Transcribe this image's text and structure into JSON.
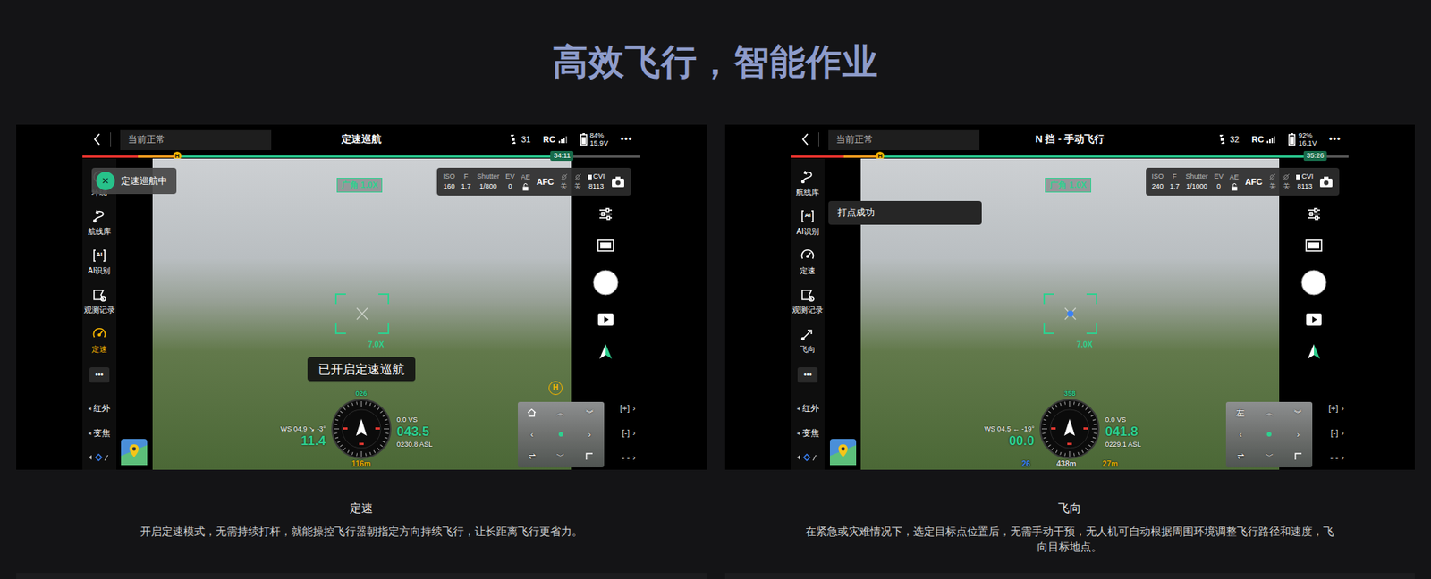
{
  "page": {
    "title": "高效飞行，智能作业"
  },
  "panels": [
    {
      "topbar": {
        "status": "当前正常",
        "mode": "定速巡航",
        "signal": "31",
        "rc": "RC",
        "battery": "84%",
        "voltage": "15.9V",
        "more": "•••"
      },
      "flight_bar": {
        "level": 0.86,
        "critical_level": 0.1,
        "low_level": 0.17,
        "home_mark": "H",
        "time": "34:11"
      },
      "toast": {
        "kind": "mode",
        "text": "定速巡航中",
        "close": "✕"
      },
      "sidebar": [
        {
          "label": "环绕",
          "kind": "orbit",
          "selected": false
        },
        {
          "label": "航线库",
          "kind": "route",
          "selected": false
        },
        {
          "label": "AI识别",
          "kind": "ai",
          "glyph": "AI",
          "selected": false
        },
        {
          "label": "观测记录",
          "kind": "record",
          "selected": false
        },
        {
          "label": "定速",
          "kind": "speed",
          "selected": true
        }
      ],
      "sidebar_more": "•••",
      "submenus": [
        {
          "label": "红外",
          "arrow": "◂"
        },
        {
          "label": "变焦",
          "arrow": "◂"
        }
      ],
      "lens": "广角 1.0X",
      "camera": {
        "params": [
          {
            "label": "ISO",
            "value": "160"
          },
          {
            "label": "F",
            "value": "1.7"
          },
          {
            "label": "Shutter",
            "value": "1/800"
          },
          {
            "label": "EV",
            "value": "0"
          }
        ],
        "ae": {
          "label": "AE",
          "locked": false
        },
        "focus": "AFC",
        "switches": [
          {
            "label": "关",
            "on": false
          },
          {
            "label": "关",
            "on": false
          }
        ],
        "codec": "CVI",
        "storage": "8113"
      },
      "reticle": {
        "zoom": "7.0X",
        "target": false
      },
      "notice": "已开启定速巡航",
      "home_marker": "H",
      "telemetry": {
        "wind": "WS 04.9 ↘ -3°",
        "speed": "11.4",
        "vs": "0.0 VS",
        "altitude": "043.5",
        "asl": "0230.8 ASL",
        "heading": "026",
        "marks": [
          {
            "text": "116m",
            "color": "#e0a800"
          }
        ]
      },
      "minimap": {
        "label": null,
        "up": "︿",
        "down": "﹀",
        "left": "‹",
        "right": "›",
        "swap": "⇌",
        "collapse": "︾"
      },
      "zoom_buttons": [
        {
          "label": "[+]",
          "arrow": "›"
        },
        {
          "label": "[-]",
          "arrow": "›"
        },
        {
          "label": "- -",
          "arrow": "›"
        }
      ],
      "caption": {
        "title": "定速",
        "text": "开启定速模式，无需持续打杆，就能操控飞行器朝指定方向持续飞行，让长距离飞行更省力。"
      }
    },
    {
      "topbar": {
        "status": "当前正常",
        "mode": "N 挡 - 手动飞行",
        "signal": "32",
        "rc": "RC",
        "battery": "92%",
        "voltage": "16.1V",
        "more": "•••"
      },
      "flight_bar": {
        "level": 0.94,
        "critical_level": 0.095,
        "low_level": 0.16,
        "home_mark": "H",
        "time": "35:26"
      },
      "toast": {
        "kind": "info",
        "text": "打点成功"
      },
      "sidebar": [
        {
          "label": "航线库",
          "kind": "route",
          "selected": false
        },
        {
          "label": "AI识别",
          "kind": "ai",
          "glyph": "AI",
          "selected": false
        },
        {
          "label": "定速",
          "kind": "speed",
          "selected": false
        },
        {
          "label": "观测记录",
          "kind": "record",
          "selected": false
        },
        {
          "label": "飞向",
          "kind": "goto",
          "selected": false
        }
      ],
      "sidebar_more": "•••",
      "submenus": [
        {
          "label": "红外",
          "arrow": "◂"
        },
        {
          "label": "变焦",
          "arrow": "◂"
        }
      ],
      "lens": "广角 1.0X",
      "camera": {
        "params": [
          {
            "label": "ISO",
            "value": "240"
          },
          {
            "label": "F",
            "value": "1.7"
          },
          {
            "label": "Shutter",
            "value": "1/1000"
          },
          {
            "label": "EV",
            "value": "0"
          }
        ],
        "ae": {
          "label": "AE",
          "locked": false
        },
        "focus": "AFC",
        "switches": [
          {
            "label": "关",
            "on": false
          },
          {
            "label": "关",
            "on": false
          }
        ],
        "codec": "CVI",
        "storage": "8113"
      },
      "reticle": {
        "zoom": "7.0X",
        "target": true
      },
      "notice": null,
      "home_marker": null,
      "telemetry": {
        "wind": "WS 04.5 ← -19°",
        "speed": "00.0",
        "vs": "0.0 VS",
        "altitude": "041.8",
        "asl": "0229.1 ASL",
        "heading": "358",
        "marks": [
          {
            "text": "26",
            "color": "#3b82f6"
          },
          {
            "text": "438m",
            "color": "#dddddd"
          },
          {
            "text": "27m",
            "color": "#e0a800"
          }
        ]
      },
      "minimap": {
        "label": "左",
        "up": "︿",
        "down": "﹀",
        "left": "‹",
        "right": "›",
        "swap": "⇌",
        "collapse": "︾"
      },
      "zoom_buttons": [
        {
          "label": "[+]",
          "arrow": "›"
        },
        {
          "label": "[-]",
          "arrow": "›"
        },
        {
          "label": "- -",
          "arrow": "›"
        }
      ],
      "caption": {
        "title": "飞向",
        "text": "在紧急或灾难情况下，选定目标点位置后，无需手动干预，无人机可自动根据周围环境调整飞行路径和速度，飞向目标地点。"
      }
    }
  ]
}
